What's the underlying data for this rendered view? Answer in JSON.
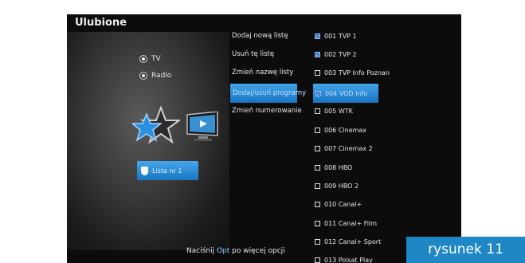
{
  "screen": {
    "title": "Ulubione",
    "modes": [
      {
        "label": "TV"
      },
      {
        "label": "Radio"
      }
    ],
    "list_button_label": "Lista nr 1",
    "menu": [
      {
        "label": "Dodaj nową listę"
      },
      {
        "label": "Usuń tę listę"
      },
      {
        "label": "Zmień nazwę listy"
      },
      {
        "label": "Dodaj/usuń programy",
        "selected": true
      },
      {
        "label": "Zmień numerowanie"
      }
    ],
    "channels": [
      {
        "label": "001 TVP 1",
        "checked": true
      },
      {
        "label": "002 TVP 2",
        "checked": true
      },
      {
        "label": "003 TVP Info Poznan",
        "checked": false
      },
      {
        "label": "004 VOD Info",
        "checked": true,
        "selected": true
      },
      {
        "label": "005 WTK",
        "checked": false
      },
      {
        "label": "006 Cinemax",
        "checked": false
      },
      {
        "label": "007 Cinemax 2",
        "checked": false
      },
      {
        "label": "008 HBO",
        "checked": false
      },
      {
        "label": "009 HBO 2",
        "checked": false
      },
      {
        "label": "010 Canal+",
        "checked": false
      },
      {
        "label": "011 Canal+ Film",
        "checked": false
      },
      {
        "label": "012 Canal+ Sport",
        "checked": false
      },
      {
        "label": "013 Polsat Play",
        "checked": false
      }
    ],
    "hint": {
      "prefix": "Naciśnij",
      "key": "Opt",
      "suffix": "po więcej opcji"
    },
    "icons": [
      "star-icon",
      "tv-icon",
      "shield-icon"
    ],
    "colors": {
      "accent": "#2f8fe0",
      "background": "#0c0c0c"
    }
  },
  "caption": "rysunek 11"
}
